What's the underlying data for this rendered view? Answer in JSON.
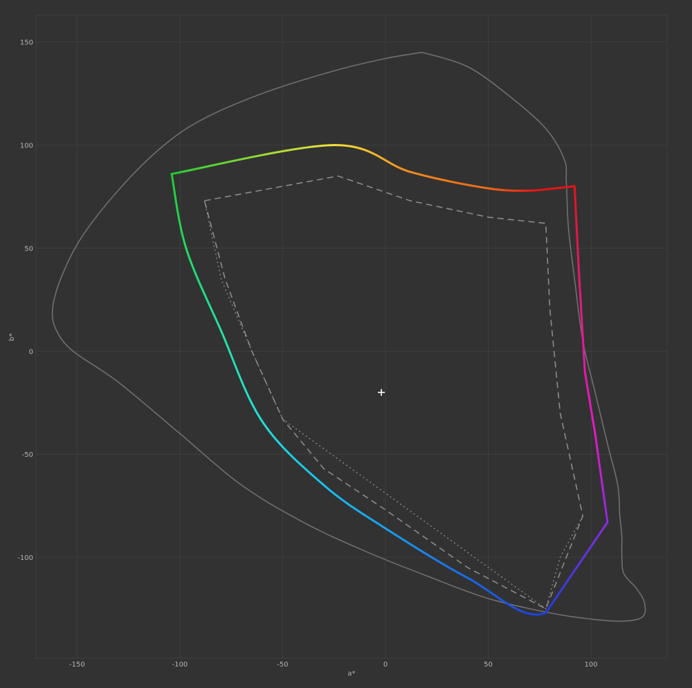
{
  "chart_data": {
    "type": "line",
    "xlabel": "a*",
    "ylabel": "b*",
    "xlim": [
      -170,
      137
    ],
    "ylim": [
      -149,
      163
    ],
    "x_ticks": [
      -150,
      -100,
      -50,
      0,
      50,
      100
    ],
    "y_ticks": [
      150,
      100,
      50,
      0,
      -50,
      -100
    ],
    "grid": true,
    "white_point": {
      "a": -2,
      "b": -20
    },
    "gamut_boundary": {
      "color": "#707070",
      "points": [
        [
          18,
          145
        ],
        [
          0,
          142
        ],
        [
          -25,
          136
        ],
        [
          -60,
          125
        ],
        [
          -90,
          112
        ],
        [
          -110,
          98
        ],
        [
          -130,
          78
        ],
        [
          -148,
          55
        ],
        [
          -158,
          35
        ],
        [
          -162,
          20
        ],
        [
          -160,
          10
        ],
        [
          -152,
          0
        ],
        [
          -130,
          -15
        ],
        [
          -100,
          -40
        ],
        [
          -70,
          -65
        ],
        [
          -40,
          -83
        ],
        [
          -10,
          -97
        ],
        [
          20,
          -109
        ],
        [
          50,
          -120
        ],
        [
          80,
          -127
        ],
        [
          100,
          -130
        ],
        [
          115,
          -131
        ],
        [
          125,
          -129
        ],
        [
          126,
          -122
        ],
        [
          122,
          -115
        ],
        [
          116,
          -108
        ],
        [
          115,
          -99
        ],
        [
          115,
          -90
        ],
        [
          114,
          -80
        ],
        [
          113,
          -65
        ],
        [
          108,
          -45
        ],
        [
          102,
          -20
        ],
        [
          96,
          5
        ],
        [
          92,
          35
        ],
        [
          89,
          60
        ],
        [
          88,
          82
        ],
        [
          87,
          93
        ],
        [
          78,
          108
        ],
        [
          60,
          124
        ],
        [
          40,
          138
        ],
        [
          18,
          145
        ]
      ]
    },
    "series": [
      {
        "style": "solid",
        "points": [
          [
            -104,
            86
          ],
          [
            -25,
            100
          ],
          [
            12,
            87
          ],
          [
            50,
            79
          ],
          [
            73,
            78
          ],
          [
            92,
            80
          ],
          [
            94,
            40
          ],
          [
            97,
            -10
          ],
          [
            102,
            -40
          ],
          [
            108,
            -83
          ],
          [
            78,
            -127
          ],
          [
            40,
            -110
          ],
          [
            0,
            -86
          ],
          [
            -30,
            -65
          ],
          [
            -60,
            -34
          ],
          [
            -80,
            10
          ],
          [
            -97,
            50
          ],
          [
            -104,
            86
          ]
        ]
      },
      {
        "style": "dashed",
        "points": [
          [
            -88,
            73
          ],
          [
            -23,
            85
          ],
          [
            12,
            73
          ],
          [
            50,
            65
          ],
          [
            78,
            62
          ],
          [
            80,
            20
          ],
          [
            85,
            -30
          ],
          [
            96,
            -80
          ],
          [
            78,
            -125
          ],
          [
            40,
            -105
          ],
          [
            0,
            -77
          ],
          [
            -30,
            -57
          ],
          [
            -50,
            -33
          ],
          [
            -65,
            0
          ],
          [
            -78,
            35
          ],
          [
            -88,
            73
          ]
        ]
      },
      {
        "style": "dotted",
        "points": [
          [
            -88,
            73
          ],
          [
            -80,
            35
          ],
          [
            -65,
            0
          ],
          [
            -50,
            -33
          ],
          [
            78,
            -125
          ],
          [
            85,
            -100
          ],
          [
            96,
            -80
          ]
        ]
      }
    ],
    "line_colors": {
      "green": "#22cc33",
      "yellow": "#f5e33a",
      "orange": "#f08a1a",
      "red": "#e61414",
      "magenta": "#e61ac8",
      "violet": "#8a2be2",
      "blue": "#1f3fe0",
      "sky": "#1aa0f0",
      "cyan": "#22e0d8",
      "gray": "#8c8c8c"
    }
  }
}
